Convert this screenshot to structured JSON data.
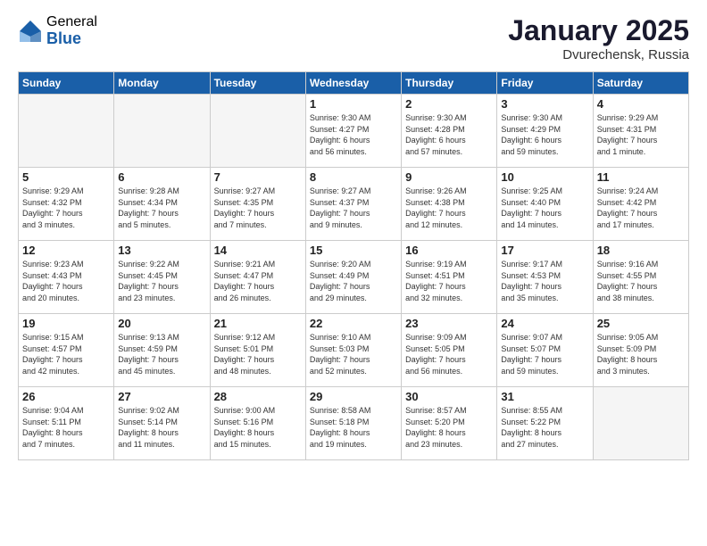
{
  "logo": {
    "general": "General",
    "blue": "Blue"
  },
  "title": "January 2025",
  "location": "Dvurechensk, Russia",
  "weekdays": [
    "Sunday",
    "Monday",
    "Tuesday",
    "Wednesday",
    "Thursday",
    "Friday",
    "Saturday"
  ],
  "weeks": [
    [
      {
        "day": "",
        "info": ""
      },
      {
        "day": "",
        "info": ""
      },
      {
        "day": "",
        "info": ""
      },
      {
        "day": "1",
        "info": "Sunrise: 9:30 AM\nSunset: 4:27 PM\nDaylight: 6 hours\nand 56 minutes."
      },
      {
        "day": "2",
        "info": "Sunrise: 9:30 AM\nSunset: 4:28 PM\nDaylight: 6 hours\nand 57 minutes."
      },
      {
        "day": "3",
        "info": "Sunrise: 9:30 AM\nSunset: 4:29 PM\nDaylight: 6 hours\nand 59 minutes."
      },
      {
        "day": "4",
        "info": "Sunrise: 9:29 AM\nSunset: 4:31 PM\nDaylight: 7 hours\nand 1 minute."
      }
    ],
    [
      {
        "day": "5",
        "info": "Sunrise: 9:29 AM\nSunset: 4:32 PM\nDaylight: 7 hours\nand 3 minutes."
      },
      {
        "day": "6",
        "info": "Sunrise: 9:28 AM\nSunset: 4:34 PM\nDaylight: 7 hours\nand 5 minutes."
      },
      {
        "day": "7",
        "info": "Sunrise: 9:27 AM\nSunset: 4:35 PM\nDaylight: 7 hours\nand 7 minutes."
      },
      {
        "day": "8",
        "info": "Sunrise: 9:27 AM\nSunset: 4:37 PM\nDaylight: 7 hours\nand 9 minutes."
      },
      {
        "day": "9",
        "info": "Sunrise: 9:26 AM\nSunset: 4:38 PM\nDaylight: 7 hours\nand 12 minutes."
      },
      {
        "day": "10",
        "info": "Sunrise: 9:25 AM\nSunset: 4:40 PM\nDaylight: 7 hours\nand 14 minutes."
      },
      {
        "day": "11",
        "info": "Sunrise: 9:24 AM\nSunset: 4:42 PM\nDaylight: 7 hours\nand 17 minutes."
      }
    ],
    [
      {
        "day": "12",
        "info": "Sunrise: 9:23 AM\nSunset: 4:43 PM\nDaylight: 7 hours\nand 20 minutes."
      },
      {
        "day": "13",
        "info": "Sunrise: 9:22 AM\nSunset: 4:45 PM\nDaylight: 7 hours\nand 23 minutes."
      },
      {
        "day": "14",
        "info": "Sunrise: 9:21 AM\nSunset: 4:47 PM\nDaylight: 7 hours\nand 26 minutes."
      },
      {
        "day": "15",
        "info": "Sunrise: 9:20 AM\nSunset: 4:49 PM\nDaylight: 7 hours\nand 29 minutes."
      },
      {
        "day": "16",
        "info": "Sunrise: 9:19 AM\nSunset: 4:51 PM\nDaylight: 7 hours\nand 32 minutes."
      },
      {
        "day": "17",
        "info": "Sunrise: 9:17 AM\nSunset: 4:53 PM\nDaylight: 7 hours\nand 35 minutes."
      },
      {
        "day": "18",
        "info": "Sunrise: 9:16 AM\nSunset: 4:55 PM\nDaylight: 7 hours\nand 38 minutes."
      }
    ],
    [
      {
        "day": "19",
        "info": "Sunrise: 9:15 AM\nSunset: 4:57 PM\nDaylight: 7 hours\nand 42 minutes."
      },
      {
        "day": "20",
        "info": "Sunrise: 9:13 AM\nSunset: 4:59 PM\nDaylight: 7 hours\nand 45 minutes."
      },
      {
        "day": "21",
        "info": "Sunrise: 9:12 AM\nSunset: 5:01 PM\nDaylight: 7 hours\nand 48 minutes."
      },
      {
        "day": "22",
        "info": "Sunrise: 9:10 AM\nSunset: 5:03 PM\nDaylight: 7 hours\nand 52 minutes."
      },
      {
        "day": "23",
        "info": "Sunrise: 9:09 AM\nSunset: 5:05 PM\nDaylight: 7 hours\nand 56 minutes."
      },
      {
        "day": "24",
        "info": "Sunrise: 9:07 AM\nSunset: 5:07 PM\nDaylight: 7 hours\nand 59 minutes."
      },
      {
        "day": "25",
        "info": "Sunrise: 9:05 AM\nSunset: 5:09 PM\nDaylight: 8 hours\nand 3 minutes."
      }
    ],
    [
      {
        "day": "26",
        "info": "Sunrise: 9:04 AM\nSunset: 5:11 PM\nDaylight: 8 hours\nand 7 minutes."
      },
      {
        "day": "27",
        "info": "Sunrise: 9:02 AM\nSunset: 5:14 PM\nDaylight: 8 hours\nand 11 minutes."
      },
      {
        "day": "28",
        "info": "Sunrise: 9:00 AM\nSunset: 5:16 PM\nDaylight: 8 hours\nand 15 minutes."
      },
      {
        "day": "29",
        "info": "Sunrise: 8:58 AM\nSunset: 5:18 PM\nDaylight: 8 hours\nand 19 minutes."
      },
      {
        "day": "30",
        "info": "Sunrise: 8:57 AM\nSunset: 5:20 PM\nDaylight: 8 hours\nand 23 minutes."
      },
      {
        "day": "31",
        "info": "Sunrise: 8:55 AM\nSunset: 5:22 PM\nDaylight: 8 hours\nand 27 minutes."
      },
      {
        "day": "",
        "info": ""
      }
    ]
  ]
}
